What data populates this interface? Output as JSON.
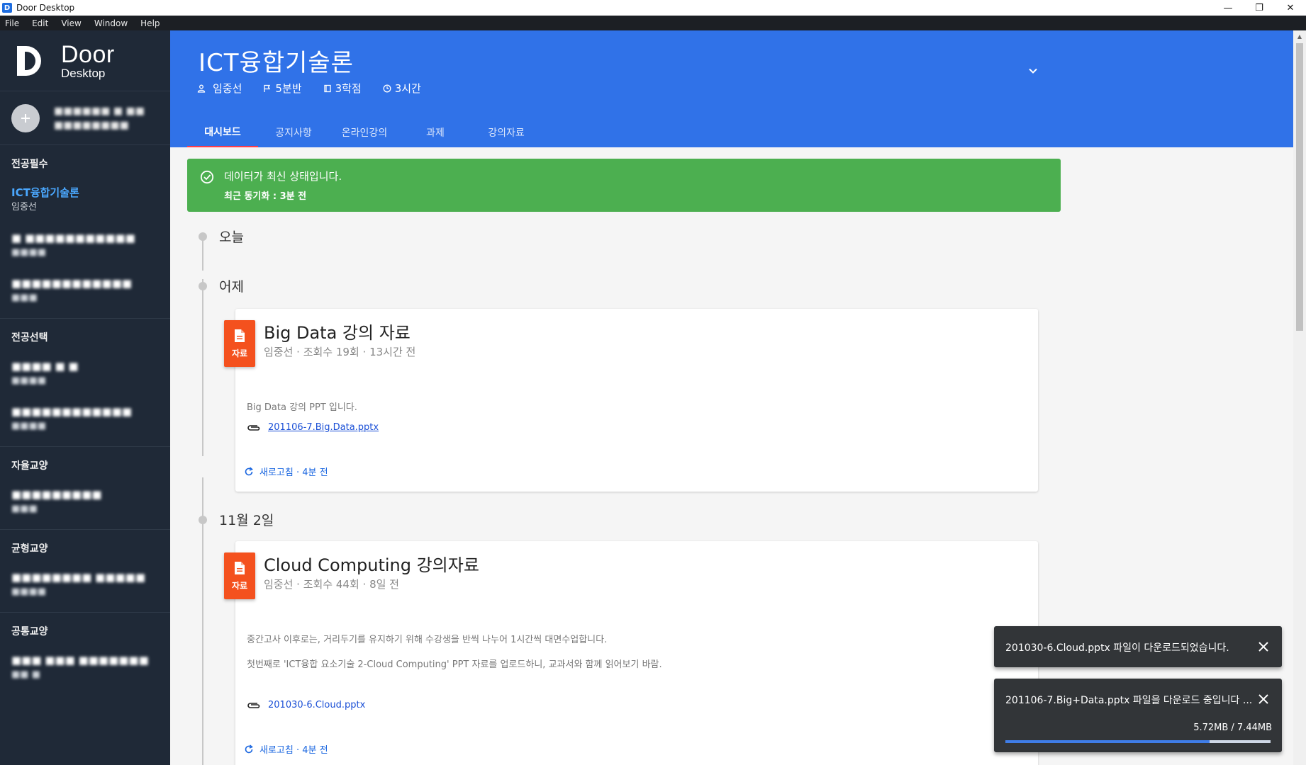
{
  "window": {
    "title": "Door Desktop",
    "app_icon_letter": "D",
    "controls": {
      "minimize": "—",
      "restore": "❐",
      "close": "✕"
    }
  },
  "menu": [
    "File",
    "Edit",
    "View",
    "Window",
    "Help"
  ],
  "brand": {
    "name": "Door",
    "subtitle": "Desktop"
  },
  "profile": {
    "line1": "■■■■■■ ■ ■■",
    "line2": "■■■■■■■■"
  },
  "sidebar": {
    "sections": [
      {
        "title": "전공필수",
        "courses": [
          {
            "name": "ICT융합기술론",
            "professor": "임중선",
            "active": true,
            "blurred": false
          },
          {
            "name": "■ ■■■■■■■■■■■",
            "professor": "■■■■",
            "active": false,
            "blurred": true
          },
          {
            "name": "■■■■■■■■■■■■",
            "professor": "■■■",
            "active": false,
            "blurred": true
          }
        ]
      },
      {
        "title": "전공선택",
        "courses": [
          {
            "name": "■■■■ ■ ■",
            "professor": "■■■■",
            "active": false,
            "blurred": true
          },
          {
            "name": "■■■■■■■■■■■■",
            "professor": "■■■■",
            "active": false,
            "blurred": true
          }
        ]
      },
      {
        "title": "자율교양",
        "courses": [
          {
            "name": "■■■■■■■■■",
            "professor": "■■■",
            "active": false,
            "blurred": true
          }
        ]
      },
      {
        "title": "균형교양",
        "courses": [
          {
            "name": "■■■■■■■■ ■■■■■",
            "professor": "■■■■",
            "active": false,
            "blurred": true
          }
        ]
      },
      {
        "title": "공통교양",
        "courses": [
          {
            "name": "■■■ ■■■ ■■■■■■■",
            "professor": "■■ ■",
            "active": false,
            "blurred": true
          }
        ]
      }
    ]
  },
  "header": {
    "course_title": "ICT융합기술론",
    "professor": "임중선",
    "section": "5분반",
    "credits": "3학점",
    "hours": "3시간",
    "tabs": [
      "대시보드",
      "공지사항",
      "온라인강의",
      "과제",
      "강의자료"
    ],
    "active_tab": "대시보드"
  },
  "banner": {
    "message": "데이터가 최신 상태입니다.",
    "sync": "최근 동기화 : 3분 전"
  },
  "timeline": [
    {
      "label": "오늘"
    },
    {
      "label": "어제"
    },
    {
      "label": "11월 2일"
    }
  ],
  "cards": [
    {
      "badge": "자료",
      "title": "Big Data 강의 자료",
      "meta": "임중선 · 조회수 19회 · 13시간 전",
      "body": [
        "Big Data 강의 PPT 입니다."
      ],
      "attachment": "201106-7.Big.Data.pptx",
      "refresh": "새로고침 · 4분 전"
    },
    {
      "badge": "자료",
      "title": "Cloud Computing 강의자료",
      "meta": "임중선 · 조회수 44회 · 8일 전",
      "body": [
        "중간고사 이후로는, 거리두기를 유지하기 위해 수강생을 반씩 나누어 1시간씩 대면수업합니다.",
        "첫번째로 'ICT융합 요소기술 2-Cloud Computing' PPT 자료를 업로드하니, 교과서와 함께 읽어보기 바람."
      ],
      "attachment": "201030-6.Cloud.pptx",
      "refresh": "새로고침 · 4분 전"
    }
  ],
  "toasts": [
    {
      "message": "201030-6.Cloud.pptx 파일이 다운로드되었습니다."
    },
    {
      "message": "201106-7.Big+Data.pptx 파일을 다운로드 중입니다 ...",
      "size": "5.72MB / 7.44MB",
      "progress": 0.77
    }
  ],
  "colors": {
    "header": "#3072e8",
    "sidebar": "#1f2937",
    "banner": "#4caf50",
    "badge": "#f4511e",
    "active_tab_underline": "#ff3d4a",
    "active_course": "#4aa8ff",
    "toast": "#323538"
  }
}
